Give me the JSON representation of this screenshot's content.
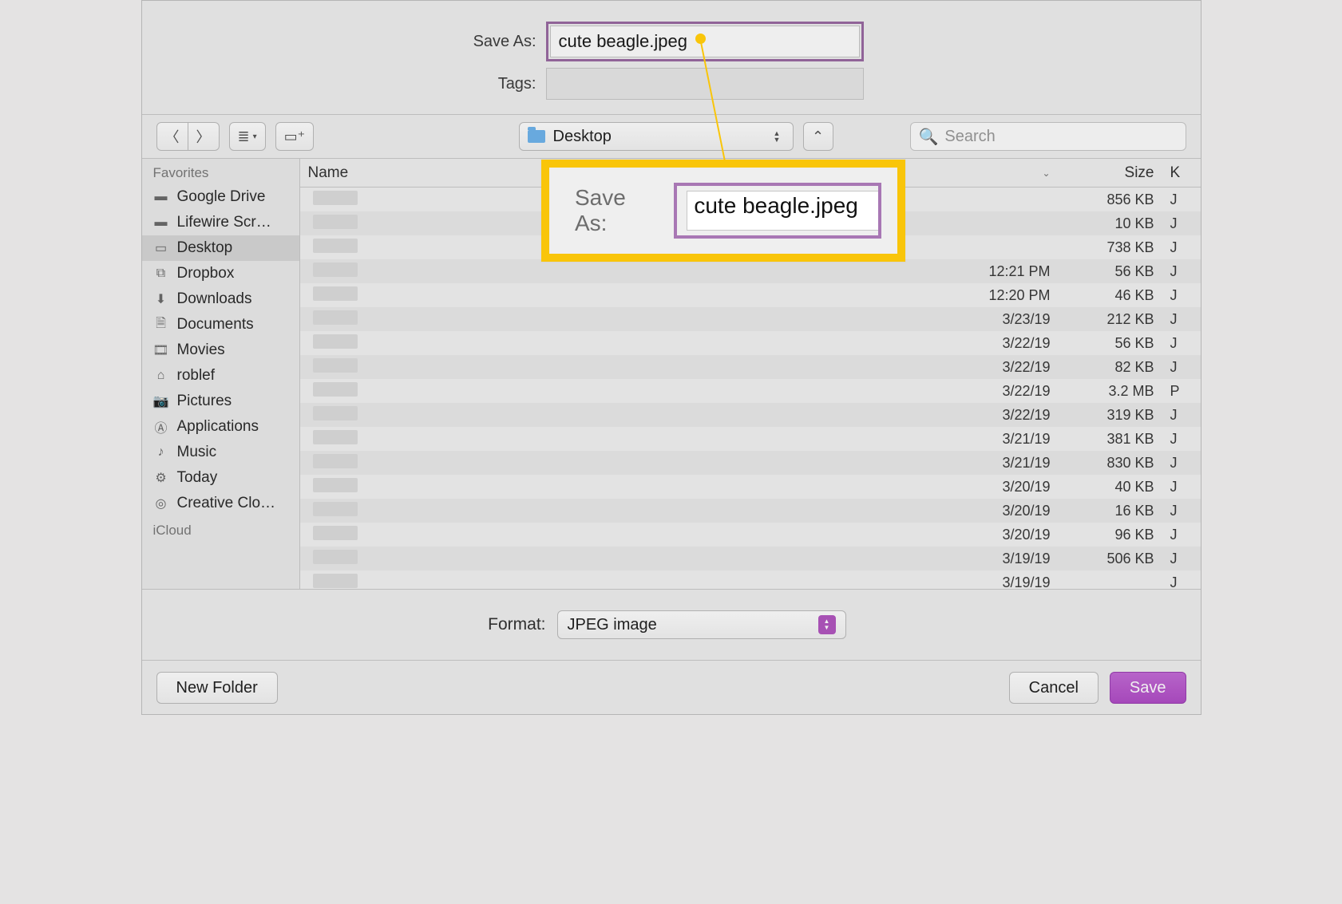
{
  "form": {
    "save_as_label": "Save As:",
    "save_as_value": "cute beagle.jpeg",
    "tags_label": "Tags:",
    "tags_value": ""
  },
  "toolbar": {
    "location_name": "Desktop",
    "search_placeholder": "Search"
  },
  "sidebar": {
    "favorites_header": "Favorites",
    "icloud_header": "iCloud",
    "items": [
      {
        "label": "Google Drive",
        "icon": "folder"
      },
      {
        "label": "Lifewire Scr…",
        "icon": "folder"
      },
      {
        "label": "Desktop",
        "icon": "desktop",
        "selected": true
      },
      {
        "label": "Dropbox",
        "icon": "dropbox"
      },
      {
        "label": "Downloads",
        "icon": "download"
      },
      {
        "label": "Documents",
        "icon": "document"
      },
      {
        "label": "Movies",
        "icon": "film"
      },
      {
        "label": "roblef",
        "icon": "home"
      },
      {
        "label": "Pictures",
        "icon": "camera"
      },
      {
        "label": "Applications",
        "icon": "app"
      },
      {
        "label": "Music",
        "icon": "music"
      },
      {
        "label": "Today",
        "icon": "gear"
      },
      {
        "label": "Creative Clo…",
        "icon": "cc"
      }
    ]
  },
  "columns": {
    "name": "Name",
    "date": "",
    "size": "Size",
    "kind": "K"
  },
  "files": [
    {
      "date": "",
      "size": "856 KB",
      "kind": "J"
    },
    {
      "date": "",
      "size": "10 KB",
      "kind": "J"
    },
    {
      "date": "",
      "size": "738 KB",
      "kind": "J"
    },
    {
      "date": "12:21 PM",
      "size": "56 KB",
      "kind": "J"
    },
    {
      "date": "12:20 PM",
      "size": "46 KB",
      "kind": "J"
    },
    {
      "date": "3/23/19",
      "size": "212 KB",
      "kind": "J"
    },
    {
      "date": "3/22/19",
      "size": "56 KB",
      "kind": "J"
    },
    {
      "date": "3/22/19",
      "size": "82 KB",
      "kind": "J"
    },
    {
      "date": "3/22/19",
      "size": "3.2 MB",
      "kind": "P"
    },
    {
      "date": "3/22/19",
      "size": "319 KB",
      "kind": "J"
    },
    {
      "date": "3/21/19",
      "size": "381 KB",
      "kind": "J"
    },
    {
      "date": "3/21/19",
      "size": "830 KB",
      "kind": "J"
    },
    {
      "date": "3/20/19",
      "size": "40 KB",
      "kind": "J"
    },
    {
      "date": "3/20/19",
      "size": "16 KB",
      "kind": "J"
    },
    {
      "date": "3/20/19",
      "size": "96 KB",
      "kind": "J"
    },
    {
      "date": "3/19/19",
      "size": "506 KB",
      "kind": "J"
    },
    {
      "date": "3/19/19",
      "size": "",
      "kind": "J"
    }
  ],
  "format": {
    "label": "Format:",
    "value": "JPEG image"
  },
  "buttons": {
    "new_folder": "New Folder",
    "cancel": "Cancel",
    "save": "Save"
  },
  "callout": {
    "label": "Save As:",
    "value": "cute beagle.jpeg"
  }
}
